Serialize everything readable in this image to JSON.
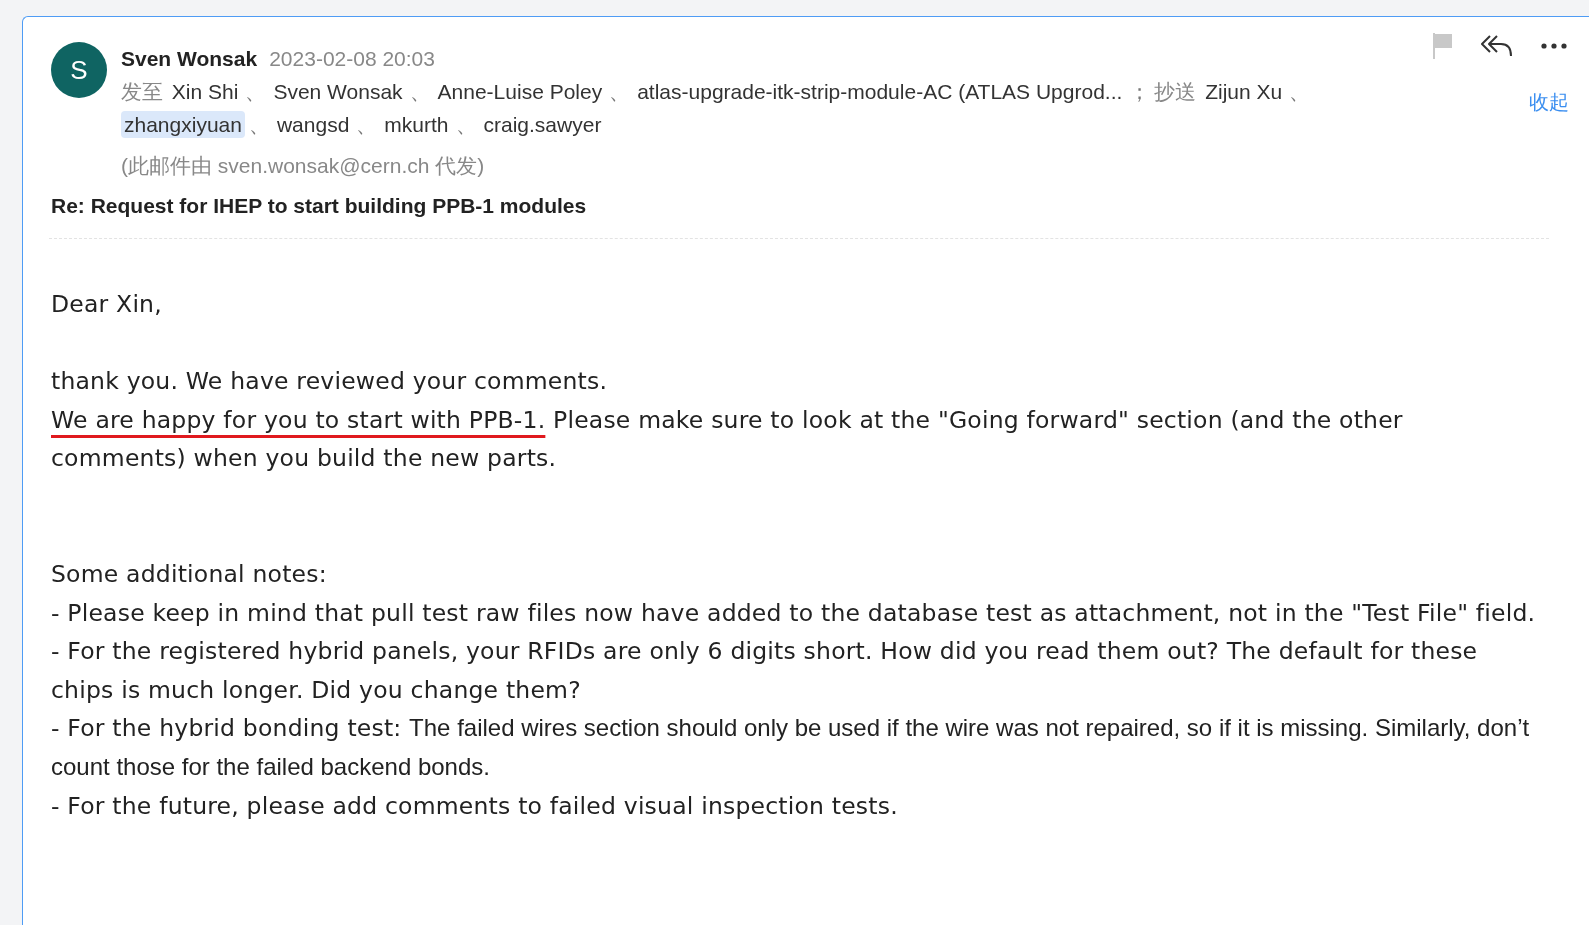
{
  "message": {
    "sender": {
      "initial": "S",
      "name": "Sven Wonsak"
    },
    "date": "2023-02-08 20:03",
    "to_label": "发至",
    "to": [
      {
        "name": "Xin Shi",
        "separator": "、",
        "selected": false
      },
      {
        "name": "Sven Wonsak",
        "separator": "、",
        "selected": false
      },
      {
        "name": "Anne-Luise Poley",
        "separator": "、",
        "selected": false
      },
      {
        "name": "atlas-upgrade-itk-strip-module-AC (ATLAS Upgrod...",
        "separator": "；",
        "selected": false
      }
    ],
    "cc_label": "抄送",
    "cc": [
      {
        "name": "Zijun Xu",
        "separator": "、",
        "selected": false
      },
      {
        "name": "zhangxiyuan",
        "separator": "、",
        "selected": true
      },
      {
        "name": "wangsd",
        "separator": "、",
        "selected": false
      },
      {
        "name": "mkurth",
        "separator": "、",
        "selected": false
      },
      {
        "name": "craig.sawyer",
        "selected": false
      }
    ],
    "collapse_link": "收起",
    "sent_on_behalf": "(此邮件由 sven.wonsak@cern.ch 代发)",
    "subject": "Re: Request for IHEP to start building PPB-1 modules",
    "body": [
      [
        {
          "segments": [
            {
              "text": "Dear Xin,",
              "kind": "plain"
            }
          ]
        }
      ],
      [
        {
          "segments": [
            {
              "text": "thank you. We have reviewed your comments.",
              "kind": "plain"
            }
          ]
        },
        {
          "segments": [
            {
              "text": "We are happy for you to start with PPB-1.",
              "kind": "underlined"
            },
            {
              "text": " Please make sure to look at the \"Going forward\" section (and the other comments) when you build the new parts.",
              "kind": "plain"
            }
          ]
        }
      ],
      [
        {
          "segments": [
            {
              "text": "Some additional notes:",
              "kind": "plain"
            }
          ]
        },
        {
          "segments": [
            {
              "text": "- Please keep in mind that pull test raw files now have added to the database test as attachment, not in the \"Test File\" field.",
              "kind": "plain"
            }
          ]
        },
        {
          "segments": [
            {
              "text": "- For the registered hybrid panels, your RFIDs are only 6 digits short. How did you read them out? The default for these chips is much longer. Did you change them?",
              "kind": "plain"
            }
          ]
        },
        {
          "segments": [
            {
              "text": "- For the hybrid bonding test: ",
              "kind": "plain"
            },
            {
              "text": "The failed wires section should only be used if the wire was not repaired, so if it is missing. Similarly, don’t count those for the failed backend bonds.",
              "kind": "pasted"
            }
          ]
        },
        {
          "segments": [
            {
              "text": "- For the future, please add comments to failed visual inspection tests.",
              "kind": "plain"
            }
          ]
        }
      ]
    ]
  }
}
